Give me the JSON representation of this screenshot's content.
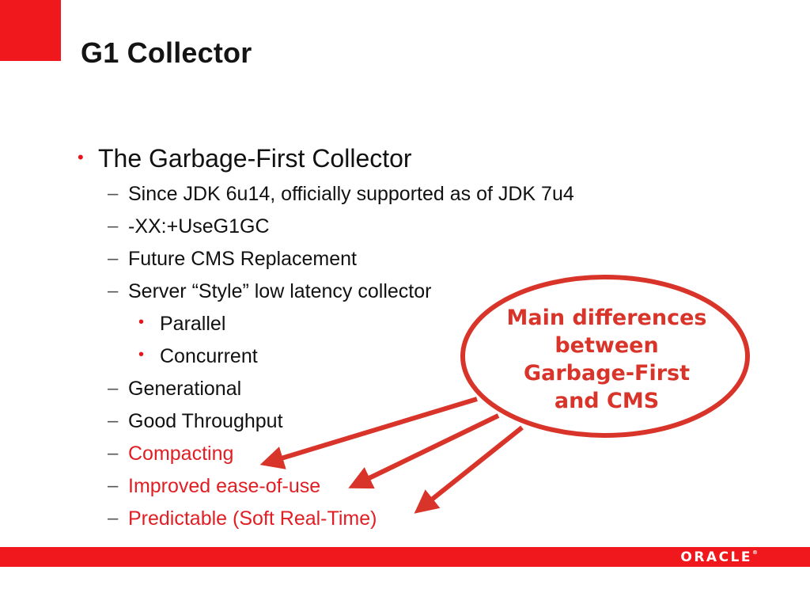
{
  "slide": {
    "title": "G1 Collector"
  },
  "bullets": {
    "main": "The Garbage-First Collector",
    "items": [
      "Since JDK 6u14, officially supported as of JDK 7u4",
      "-XX:+UseG1GC",
      "Future CMS Replacement",
      "Server “Style” low latency collector",
      "Generational",
      "Good Throughput",
      "Compacting",
      "Improved ease-of-use",
      "Predictable (Soft Real-Time)"
    ],
    "sub_items": [
      "Parallel",
      "Concurrent"
    ]
  },
  "callout": {
    "lines": [
      "Main differences",
      "between",
      "Garbage-First",
      "and CMS"
    ]
  },
  "footer": {
    "logo_text": "ORACLE",
    "logo_mark": "®"
  },
  "colors": {
    "accent_red": "#f0171d",
    "highlight_text": "#e01e24",
    "callout_red": "#d9342a"
  },
  "glyphs": {
    "bullet": "•",
    "dash": "–"
  }
}
